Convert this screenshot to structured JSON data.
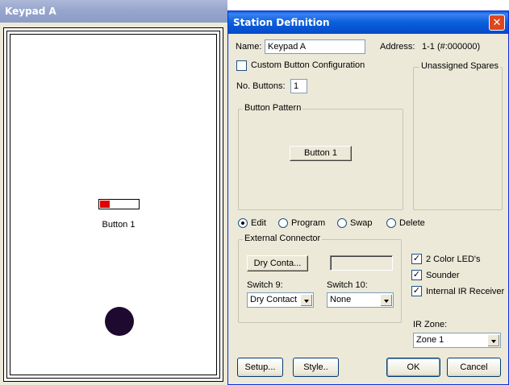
{
  "keypad_window": {
    "title": "Keypad A",
    "button_label": "Button 1"
  },
  "dialog": {
    "title": "Station Definition",
    "close_glyph": "✕",
    "name_label": "Name:",
    "name_value": "Keypad A",
    "address_label": "Address:",
    "address_value": "1-1 (#:000000)",
    "custom_config_label": "Custom Button Configuration",
    "custom_config_checked": false,
    "num_buttons_label": "No. Buttons:",
    "num_buttons_value": "1",
    "unassigned_spares_title": "Unassigned Spares",
    "button_pattern_title": "Button Pattern",
    "pattern_button_label": "Button 1",
    "modes": [
      {
        "label": "Edit",
        "selected": true
      },
      {
        "label": "Program",
        "selected": false
      },
      {
        "label": "Swap",
        "selected": false
      },
      {
        "label": "Delete",
        "selected": false
      }
    ],
    "external_connector_title": "External Connector",
    "dry_contact_button": "Dry Conta...",
    "switch9_label": "Switch 9:",
    "switch9_value": "Dry Contact",
    "switch10_label": "Switch 10:",
    "switch10_value": "None",
    "two_color_leds_label": "2 Color LED's",
    "two_color_leds_checked": true,
    "sounder_label": "Sounder",
    "sounder_checked": true,
    "internal_ir_label": "Internal IR Receiver",
    "internal_ir_checked": true,
    "ir_zone_label": "IR Zone:",
    "ir_zone_value": "Zone 1",
    "setup_button": "Setup...",
    "style_button": "Style..",
    "ok_button": "OK",
    "cancel_button": "Cancel",
    "check_glyph": "✓"
  }
}
